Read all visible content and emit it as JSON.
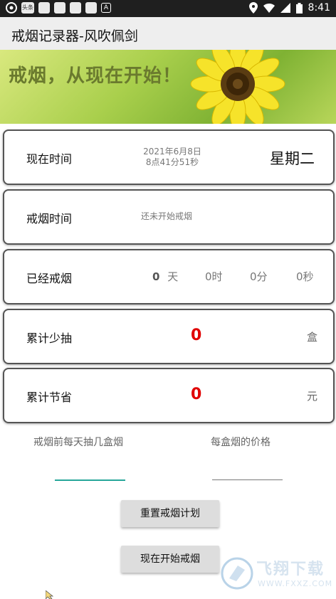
{
  "statusbar": {
    "time": "8:41",
    "notif_badge": "头条",
    "a_label": "A"
  },
  "appbar": {
    "title": "戒烟记录器-风吹佩剑"
  },
  "banner": {
    "slogan": "戒烟，从现在开始！"
  },
  "cards": {
    "now": {
      "label": "现在时间",
      "date": "2021年6月8日",
      "time": "8点41分51秒",
      "weekday": "星期二"
    },
    "quit": {
      "label": "戒烟时间",
      "value": "还未开始戒烟"
    },
    "elapsed": {
      "label": "已经戒烟",
      "days_num": "0",
      "days_unit": "天",
      "hours": "0时",
      "minutes": "0分",
      "seconds": "0秒"
    },
    "less": {
      "label": "累计少抽",
      "value": "0",
      "unit": "盒"
    },
    "saved": {
      "label": "累计节省",
      "value": "0",
      "unit": "元"
    }
  },
  "inputs": {
    "per_day_label": "戒烟前每天抽几盒烟",
    "price_label": "每盒烟的价格",
    "accent_color": "#26a69a"
  },
  "buttons": {
    "reset": "重置戒烟计划",
    "start": "现在开始戒烟"
  },
  "watermark": {
    "brand": "飞翔下载",
    "url": "WWW.FXXZ.COM"
  }
}
